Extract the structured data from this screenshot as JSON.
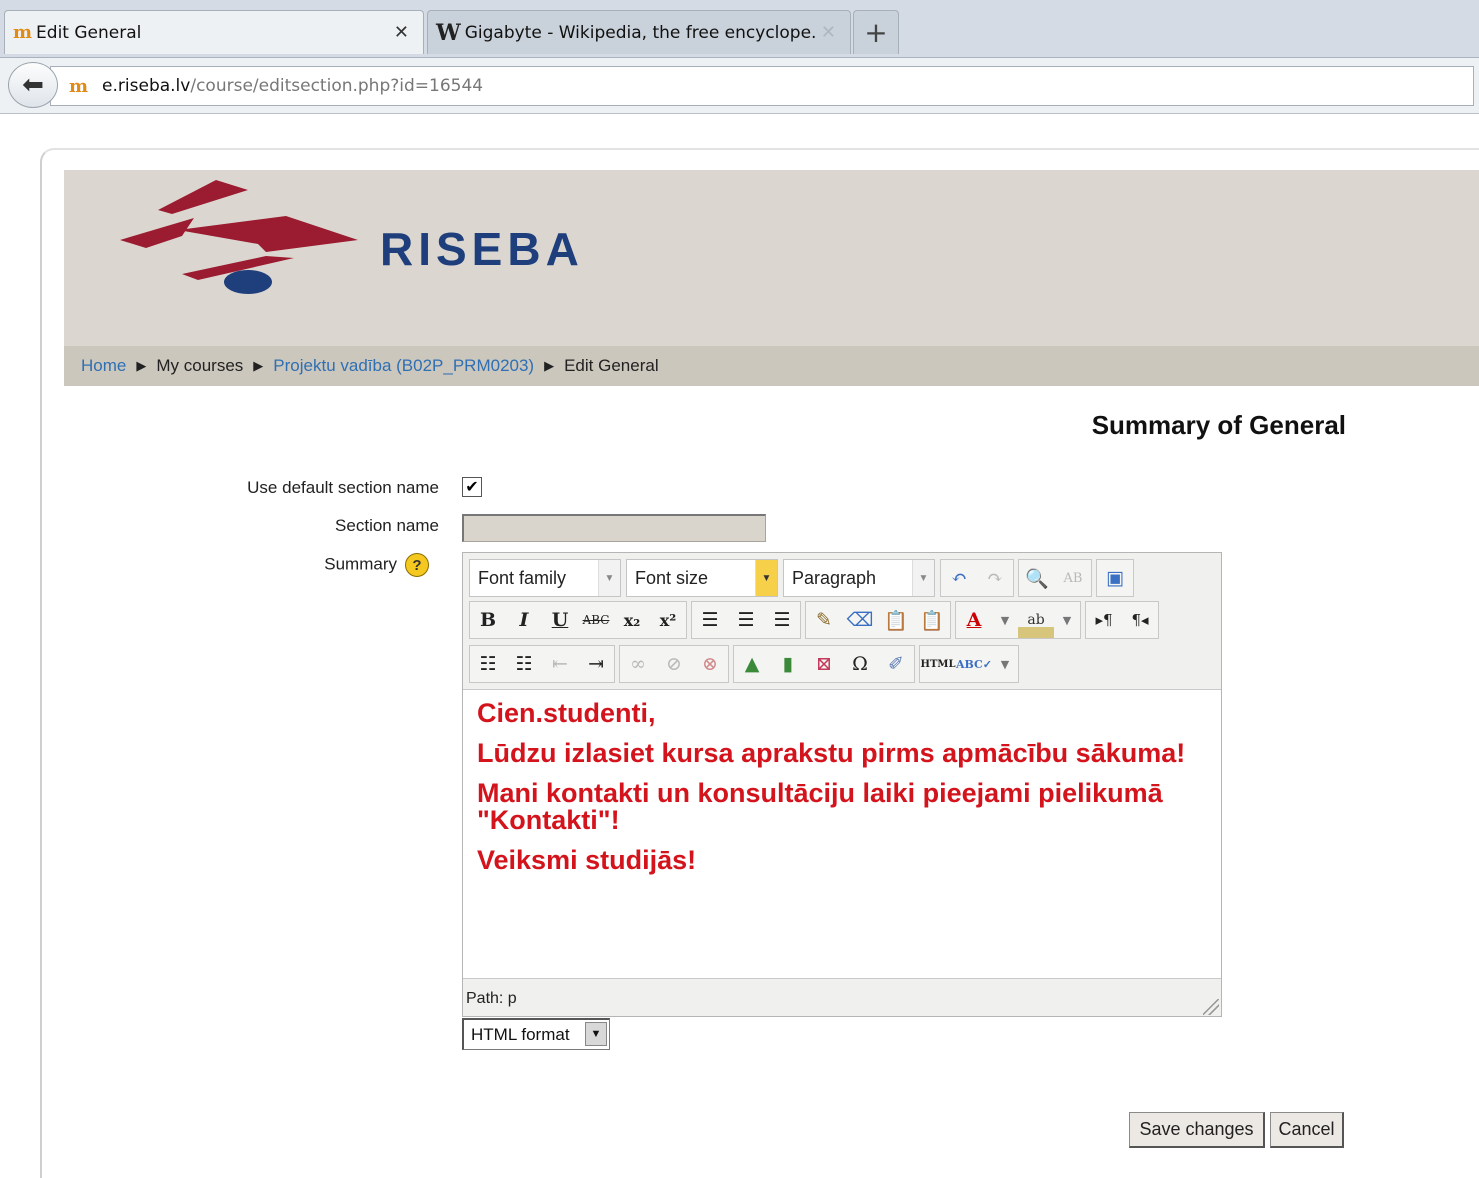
{
  "browser": {
    "tabs": [
      {
        "title": "Edit General",
        "favicon": "moodle-icon",
        "active": true
      },
      {
        "title": "Gigabyte - Wikipedia, the free encyclope...",
        "favicon": "wikipedia-icon",
        "active": false
      }
    ],
    "url_host": "e.riseba.lv",
    "url_path": "/course/editsection.php?id=16544"
  },
  "header": {
    "logo_text": "RISEBA"
  },
  "breadcrumb": {
    "home": "Home",
    "my_courses": "My courses",
    "course": "Projektu vadība (B02P_PRM0203)",
    "current": "Edit General"
  },
  "form": {
    "title": "Summary of General",
    "use_default_label": "Use default section name",
    "use_default_checked": true,
    "section_name_label": "Section name",
    "section_name_value": "",
    "summary_label": "Summary"
  },
  "editor": {
    "font_family": "Font family",
    "font_size": "Font size",
    "block_format": "Paragraph",
    "content": [
      "Cien.studenti,",
      "Lūdzu izlasiet kursa aprakstu pirms apmācību sākuma!",
      "Mani kontakti un konsultāciju laiki pieejami pielikumā \"Kontakti\"!",
      "Veiksmi studijās!"
    ],
    "content_color": "#d4141c",
    "path": "Path: p",
    "format": "HTML format"
  },
  "buttons": {
    "save": "Save changes",
    "cancel": "Cancel"
  }
}
